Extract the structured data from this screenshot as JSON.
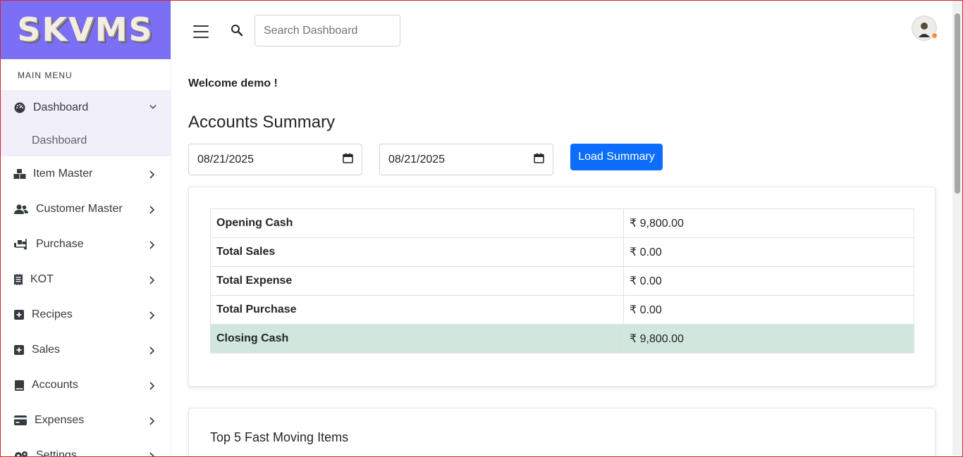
{
  "brand": {
    "logo_text": "SKVMS"
  },
  "sidebar": {
    "caption": "MAIN MENU",
    "dashboard": {
      "label": "Dashboard",
      "sub_item": "Dashboard"
    },
    "items": [
      {
        "label": "Item Master",
        "icon": "boxes-icon"
      },
      {
        "label": "Customer Master",
        "icon": "users-icon"
      },
      {
        "label": "Purchase",
        "icon": "truck-loading-icon"
      },
      {
        "label": "KOT",
        "icon": "receipt-icon"
      },
      {
        "label": "Recipes",
        "icon": "plus-square-icon"
      },
      {
        "label": "Sales",
        "icon": "plus-square-icon"
      },
      {
        "label": "Accounts",
        "icon": "book-icon"
      },
      {
        "label": "Expenses",
        "icon": "credit-card-icon"
      },
      {
        "label": "Settings",
        "icon": "gears-icon"
      }
    ]
  },
  "topbar": {
    "search_placeholder": "Search Dashboard"
  },
  "main": {
    "welcome": "Welcome demo !",
    "title": "Accounts Summary",
    "from_date": "08/21/2025",
    "to_date": "08/21/2025",
    "load_button": "Load Summary",
    "summary_rows": [
      {
        "label": "Opening Cash",
        "value": "₹ 9,800.00"
      },
      {
        "label": "Total Sales",
        "value": "₹ 0.00"
      },
      {
        "label": "Total Expense",
        "value": "₹ 0.00"
      },
      {
        "label": "Total Purchase",
        "value": "₹ 0.00"
      },
      {
        "label": "Closing Cash",
        "value": "₹ 9,800.00"
      }
    ],
    "top5_title": "Top 5 Fast Moving Items"
  },
  "colors": {
    "brand": "#7a6ff5",
    "primary": "#0d6efd",
    "closing_row": "#d1e7dd"
  }
}
